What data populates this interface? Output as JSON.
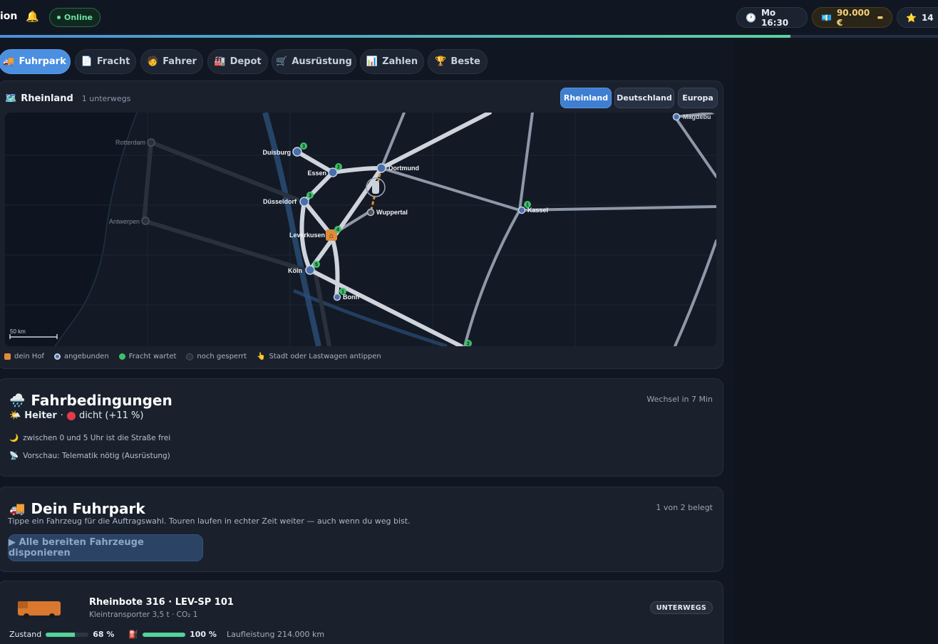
{
  "app": {
    "title_fragment": "ion",
    "bell_icon": "bell-icon",
    "status": "Online"
  },
  "header": {
    "time": "Mo 16:30",
    "money": "90.000 €",
    "stars": "14",
    "day_progress": 0.843
  },
  "tabs": [
    {
      "label": "Fuhrpark",
      "icon": "🚚"
    },
    {
      "label": "Fracht",
      "icon": "📄"
    },
    {
      "label": "Fahrer",
      "icon": "🧑"
    },
    {
      "label": "Depot",
      "icon": "🏭"
    },
    {
      "label": "Ausrüstung",
      "icon": "🛒"
    },
    {
      "label": "Zahlen",
      "icon": "📊"
    },
    {
      "label": "Beste",
      "icon": "🏆"
    }
  ],
  "map": {
    "title": "Rheinland",
    "subtitle": "1 unterwegs",
    "regions": [
      "Rheinland",
      "Deutschland",
      "Europa"
    ],
    "scale": "50 km",
    "cities": {
      "rotterdam": "Rotterdam",
      "antwerpen": "Antwerpen",
      "duisburg": "Duisburg",
      "essen": "Essen",
      "dortmund": "Dortmund",
      "duesseldorf": "Düsseldorf",
      "wuppertal": "Wuppertal",
      "leverkusen": "Leverkusen",
      "koeln": "Köln",
      "bonn": "Bonn",
      "kassel": "Kassel",
      "magdeburg": "Magdebu"
    },
    "badges": {
      "duisburg": "3",
      "essen": "2",
      "duesseldorf": "3",
      "leverkusen": "4",
      "koeln": "5",
      "bonn": "1",
      "kassel": "1",
      "south": "2"
    },
    "legend": [
      {
        "label": "dein Hof",
        "color": "#e08a3c"
      },
      {
        "label": "angebunden",
        "color": "#4a6fa8"
      },
      {
        "label": "Fracht wartet",
        "color": "#3fbf6a"
      },
      {
        "label": "noch gesperrt",
        "color": "#3b4454"
      },
      {
        "label": "Stadt oder Lastwagen antippen",
        "color": ""
      }
    ]
  },
  "conditions": {
    "title": "Fahrbedingungen",
    "change": "Wechsel in 7 Min",
    "weather": "Heiter",
    "traffic": "dicht (+11 %)",
    "note1": "zwischen 0 und 5 Uhr ist die Straße frei",
    "note2": "Vorschau: Telematik nötig (Ausrüstung)"
  },
  "fleet": {
    "title": "Dein Fuhrpark",
    "occupancy": "1 von 2 belegt",
    "description": "Tippe ein Fahrzeug für die Auftragswahl. Touren laufen in echter Zeit weiter — auch wenn du weg bist.",
    "dispatch_label": "▶ Alle bereiten Fahrzeuge disponieren"
  },
  "vehicle": {
    "name": "Rheinbote 316 · LEV-SP 101",
    "sub": "Kleintransporter 3,5 t · CO₂ 1",
    "status": "UNTERWEGS",
    "condition_label": "Zustand",
    "condition": "68 %",
    "condition_frac": 0.68,
    "fuel": "100 %",
    "fuel_frac": 1.0,
    "mileage": "Laufleistung 214.000 km"
  }
}
